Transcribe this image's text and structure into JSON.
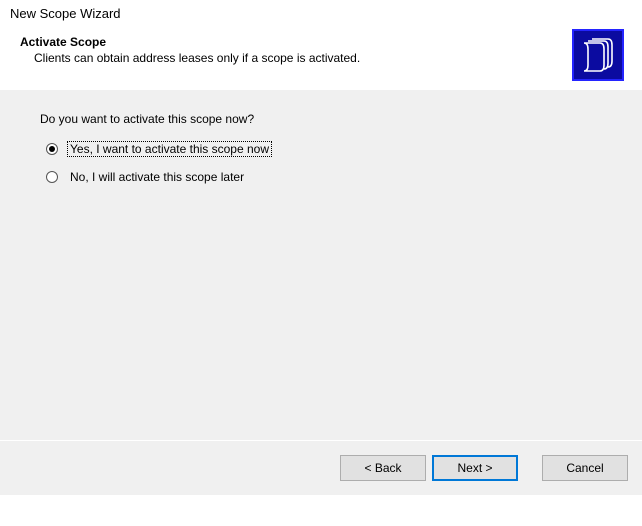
{
  "window": {
    "title": "New Scope Wizard"
  },
  "header": {
    "title": "Activate Scope",
    "description": "Clients can obtain address leases only if a scope is activated."
  },
  "body": {
    "question": "Do you want to activate this scope now?",
    "options": [
      {
        "label": "Yes, I want to activate this scope now",
        "selected": true
      },
      {
        "label": "No, I will activate this scope later",
        "selected": false
      }
    ]
  },
  "footer": {
    "back": "< Back",
    "next": "Next >",
    "cancel": "Cancel"
  }
}
